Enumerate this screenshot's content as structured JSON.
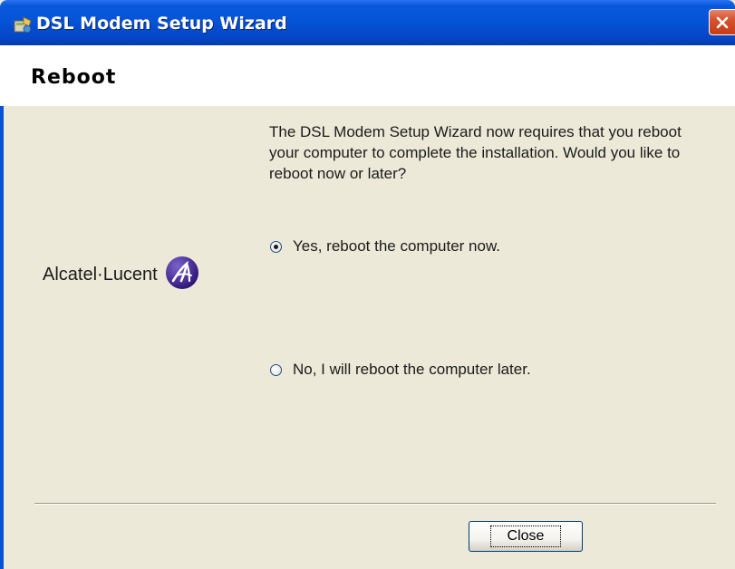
{
  "window": {
    "title": "DSL Modem Setup Wizard",
    "icon": "wizard-app-icon",
    "close_icon": "close-icon"
  },
  "header": {
    "title": "Reboot"
  },
  "logo": {
    "text": "Alcatel·Lucent",
    "icon": "alcatel-lucent-logo-icon"
  },
  "message": "The DSL Modem Setup Wizard now requires that you reboot your computer to complete the installation.  Would you like to reboot now or later?",
  "options": [
    {
      "label": "Yes, reboot the computer now.",
      "selected": true
    },
    {
      "label": "No, I will reboot the computer later.",
      "selected": false
    }
  ],
  "footer": {
    "close_label": "Close"
  },
  "colors": {
    "titlebar": "#0553d6",
    "window_bg": "#ece9d8",
    "header_bg": "#ffffff",
    "close_button_red": "#d7522e",
    "logo_purple": "#4b2c8a"
  }
}
